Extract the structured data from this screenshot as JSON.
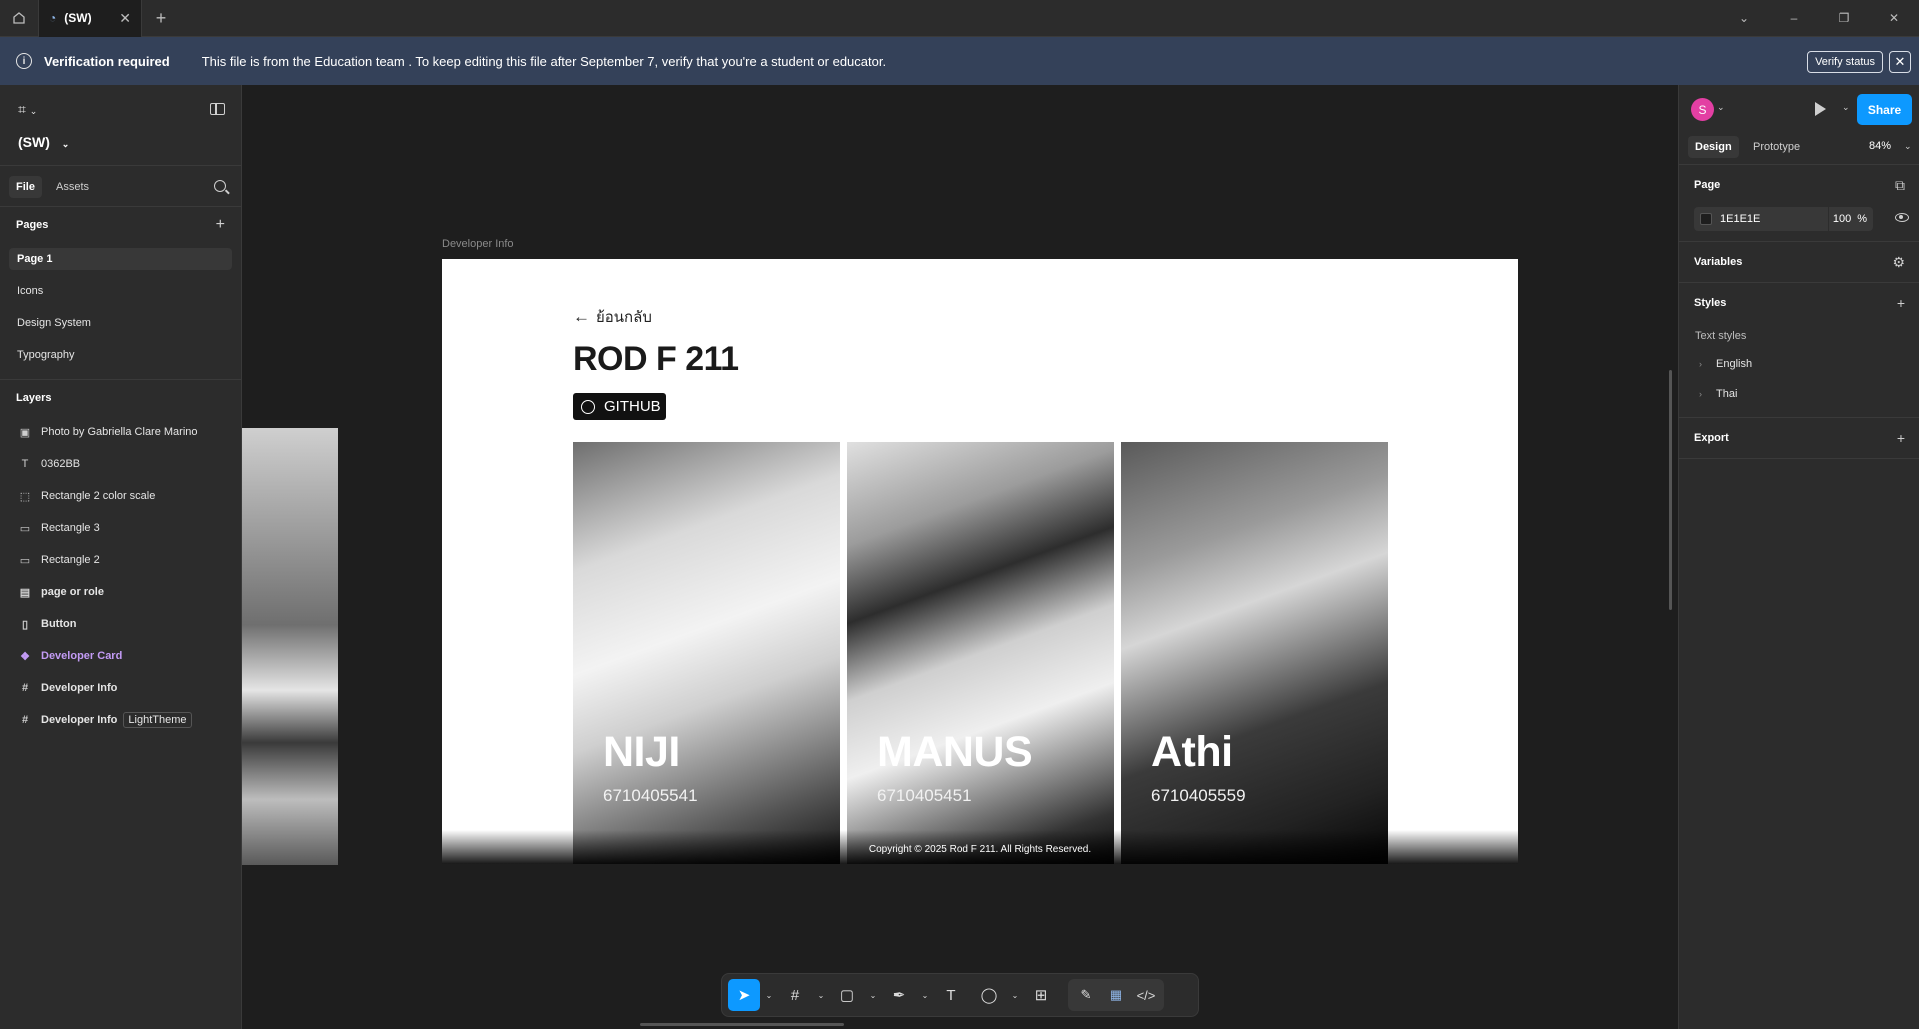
{
  "titlebar": {
    "tab_name": "(SW)"
  },
  "banner": {
    "title": "Verification required",
    "message": "This file is from the Education team . To keep editing this file after September 7, verify that you're a student or educator.",
    "verify_label": "Verify status"
  },
  "left": {
    "file_name": "(SW)",
    "tabs": {
      "file": "File",
      "assets": "Assets"
    },
    "pages_header": "Pages",
    "pages": [
      "Page 1",
      "Icons",
      "Design System",
      "Typography"
    ],
    "layers_header": "Layers",
    "layers": [
      {
        "label": "Photo by Gabriella Clare Marino",
        "icon": "image-icon",
        "glyph": "▣"
      },
      {
        "label": "0362BB",
        "icon": "text-icon",
        "glyph": "T"
      },
      {
        "label": "Rectangle 2 color scale",
        "icon": "dashed-rectangle-icon",
        "glyph": "⬚"
      },
      {
        "label": "Rectangle 3",
        "icon": "rectangle-icon",
        "glyph": "▭"
      },
      {
        "label": "Rectangle 2",
        "icon": "rectangle-icon",
        "glyph": "▭"
      },
      {
        "label": "page or role",
        "icon": "section-icon",
        "glyph": "▤"
      },
      {
        "label": "Button",
        "icon": "auto-layout-icon",
        "glyph": "▯"
      },
      {
        "label": "Developer Card",
        "icon": "component-icon",
        "glyph": "❖"
      },
      {
        "label": "Developer Info",
        "icon": "frame-icon",
        "glyph": "#"
      },
      {
        "label": "Developer Info",
        "icon": "frame-icon",
        "glyph": "#",
        "tag": "LightTheme"
      }
    ]
  },
  "right": {
    "avatar_letter": "S",
    "share_label": "Share",
    "tabs": {
      "design": "Design",
      "prototype": "Prototype"
    },
    "zoom": "84%",
    "page_header": "Page",
    "page_fill_hex": "1E1E1E",
    "page_fill_opacity": "100",
    "percent_sign": "%",
    "variables_header": "Variables",
    "styles_header": "Styles",
    "text_styles_label": "Text styles",
    "text_styles": [
      "English",
      "Thai"
    ],
    "export_header": "Export"
  },
  "canvas": {
    "frame_label": "Developer Info",
    "back_label": "ย้อนกลับ",
    "title": "ROD F 211",
    "github_label": "GITHUB",
    "cards": [
      {
        "name": "NIJI",
        "id": "6710405541"
      },
      {
        "name": "MANUS",
        "id": "6710405451"
      },
      {
        "name": "Athi",
        "id": "6710405559"
      }
    ],
    "copyright": "Copyright © 2025 Rod F 211. All Rights Reserved."
  },
  "toolbar": {
    "tools": [
      "move-tool",
      "frame-tool",
      "shape-tool",
      "pen-tool",
      "text-tool",
      "comment-tool",
      "actions-tool"
    ]
  },
  "colors": {
    "accent": "#0d99ff",
    "banner": "#344159",
    "avatar": "#e33fa3",
    "component": "#c39bf5"
  }
}
